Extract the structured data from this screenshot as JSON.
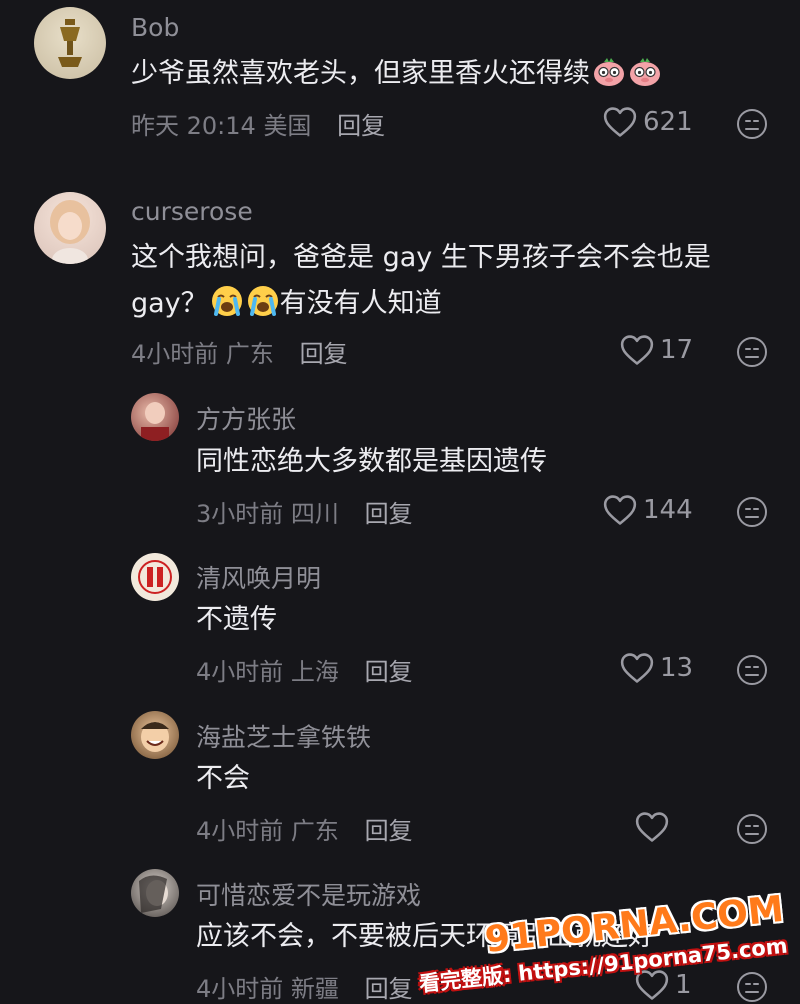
{
  "comments": [
    {
      "username": "Bob",
      "line1": "少爷虽然喜欢老头，但家里香火还得续",
      "emoji_count": 2,
      "time": "昨天 20:14",
      "location": "美国",
      "reply_label": "回复",
      "likes": "621"
    },
    {
      "username": "curserose",
      "line1": "这个我想问，爸爸是 gay 生下男孩子会不会也是",
      "line2_before": "gay？",
      "line2_after": "有没有人知道",
      "time": "4小时前",
      "location": "广东",
      "reply_label": "回复",
      "likes": "17",
      "replies": [
        {
          "username": "方方张张",
          "line1": "同性恋绝大多数都是基因遗传",
          "time": "3小时前",
          "location": "四川",
          "reply_label": "回复",
          "likes": "144"
        },
        {
          "username": "清风唤月明",
          "line1": "不遗传",
          "time": "4小时前",
          "location": "上海",
          "reply_label": "回复",
          "likes": "13"
        },
        {
          "username": "海盐芝士拿铁铁",
          "line1": "不会",
          "time": "4小时前",
          "location": "广东",
          "reply_label": "回复",
          "likes": ""
        },
        {
          "username": "可惜恋爱不是玩游戏",
          "line1": "应该不会，不要被后天环境引出就还好",
          "time": "4小时前",
          "location": "新疆",
          "reply_label": "回复",
          "likes": "1"
        }
      ]
    }
  ],
  "watermark": {
    "main": "91PORNA.COM",
    "sub": "看完整版: https://91porna75.com"
  },
  "icons": {
    "like": "heart-outline-icon",
    "dislike": "neutral-face-icon",
    "emoji_pig": "pig-glasses-emoji",
    "emoji_cry": "crying-face-emoji"
  },
  "colors": {
    "background": "#16161a",
    "text": "#ececf0",
    "muted": "#7d7d85"
  }
}
